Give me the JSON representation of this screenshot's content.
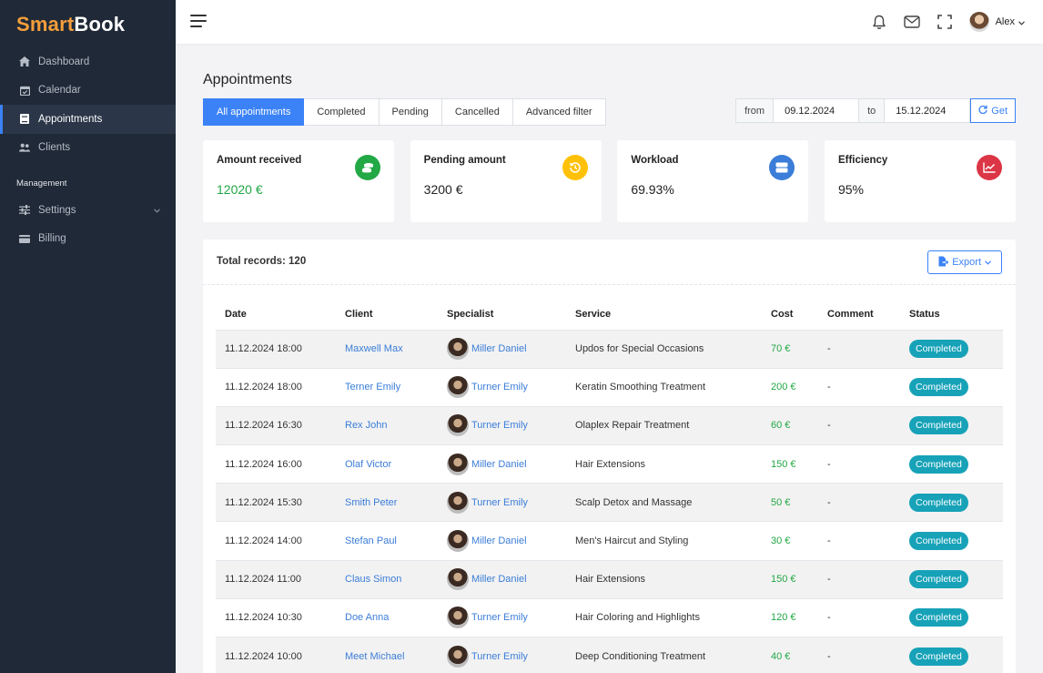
{
  "brand": {
    "part1": "Smart",
    "part2": "Book"
  },
  "sidebar": {
    "items": [
      {
        "label": "Dashboard",
        "icon": "home-icon"
      },
      {
        "label": "Calendar",
        "icon": "calendar-icon"
      },
      {
        "label": "Appointments",
        "icon": "book-icon",
        "active": true
      },
      {
        "label": "Clients",
        "icon": "users-icon"
      }
    ],
    "section_label": "Management",
    "management_items": [
      {
        "label": "Settings",
        "icon": "sliders-icon"
      },
      {
        "label": "Billing",
        "icon": "credit-card-icon"
      }
    ]
  },
  "topbar": {
    "user_name": "Alex"
  },
  "page": {
    "title": "Appointments",
    "tabs": [
      "All appointments",
      "Completed",
      "Pending",
      "Cancelled",
      "Advanced filter"
    ],
    "active_tab": "All appointments"
  },
  "daterange": {
    "from_label": "from",
    "from_value": "09.12.2024",
    "to_label": "to",
    "to_value": "15.12.2024",
    "button_label": "Get"
  },
  "stats": [
    {
      "label": "Amount received",
      "value": "12020 €",
      "color": "#22a845",
      "icon": "coins-icon"
    },
    {
      "label": "Pending amount",
      "value": "3200 €",
      "color": "#ffc107",
      "icon": "history-icon"
    },
    {
      "label": "Workload",
      "value": "69.93%",
      "color": "#3b7dd8",
      "icon": "server-icon"
    },
    {
      "label": "Efficiency",
      "value": "95%",
      "color": "#dc3545",
      "icon": "chart-line-icon"
    }
  ],
  "table": {
    "total_label": "Total records: 120",
    "export_label": "Export",
    "columns": [
      "Date",
      "Client",
      "Specialist",
      "Service",
      "Cost",
      "Comment",
      "Status"
    ],
    "rows": [
      {
        "date": "11.12.2024 18:00",
        "client": "Maxwell Max",
        "specialist": "Miller Daniel",
        "service": "Updos for Special Occasions",
        "cost": "70 €",
        "comment": "-",
        "status": "Completed"
      },
      {
        "date": "11.12.2024 18:00",
        "client": "Terner Emily",
        "specialist": "Turner Emily",
        "service": "Keratin Smoothing Treatment",
        "cost": "200 €",
        "comment": "-",
        "status": "Completed"
      },
      {
        "date": "11.12.2024 16:30",
        "client": "Rex John",
        "specialist": "Turner Emily",
        "service": "Olaplex Repair Treatment",
        "cost": "60 €",
        "comment": "-",
        "status": "Completed"
      },
      {
        "date": "11.12.2024 16:00",
        "client": "Olaf Victor",
        "specialist": "Miller Daniel",
        "service": "Hair Extensions",
        "cost": "150 €",
        "comment": "-",
        "status": "Completed"
      },
      {
        "date": "11.12.2024 15:30",
        "client": "Smith Peter",
        "specialist": "Turner Emily",
        "service": "Scalp Detox and Massage",
        "cost": "50 €",
        "comment": "-",
        "status": "Completed"
      },
      {
        "date": "11.12.2024 14:00",
        "client": "Stefan Paul",
        "specialist": "Miller Daniel",
        "service": "Men's Haircut and Styling",
        "cost": "30 €",
        "comment": "-",
        "status": "Completed"
      },
      {
        "date": "11.12.2024 11:00",
        "client": "Claus Simon",
        "specialist": "Miller Daniel",
        "service": "Hair Extensions",
        "cost": "150 €",
        "comment": "-",
        "status": "Completed"
      },
      {
        "date": "11.12.2024 10:30",
        "client": "Doe Anna",
        "specialist": "Turner Emily",
        "service": "Hair Coloring and Highlights",
        "cost": "120 €",
        "comment": "-",
        "status": "Completed"
      },
      {
        "date": "11.12.2024 10:00",
        "client": "Meet Michael",
        "specialist": "Turner Emily",
        "service": "Deep Conditioning Treatment",
        "cost": "40 €",
        "comment": "-",
        "status": "Completed"
      }
    ]
  }
}
